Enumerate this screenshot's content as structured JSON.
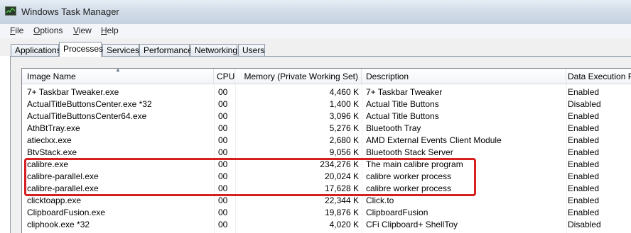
{
  "window": {
    "title": "Windows Task Manager"
  },
  "menu": [
    "File",
    "Options",
    "View",
    "Help"
  ],
  "tabs": [
    "Applications",
    "Processes",
    "Services",
    "Performance",
    "Networking",
    "Users"
  ],
  "active_tab": "Processes",
  "columns": {
    "name": "Image Name",
    "cpu": "CPU",
    "memory": "Memory (Private Working Set)",
    "description": "Description",
    "dep": "Data Execution Pre"
  },
  "rows": [
    {
      "name": "7+ Taskbar Tweaker.exe",
      "cpu": "00",
      "memory": "4,460 K",
      "description": "7+ Taskbar Tweaker",
      "dep": "Enabled"
    },
    {
      "name": "ActualTitleButtonsCenter.exe *32",
      "cpu": "00",
      "memory": "1,400 K",
      "description": "Actual Title Buttons",
      "dep": "Disabled"
    },
    {
      "name": "ActualTitleButtonsCenter64.exe",
      "cpu": "00",
      "memory": "3,096 K",
      "description": "Actual Title Buttons",
      "dep": "Enabled"
    },
    {
      "name": "AthBtTray.exe",
      "cpu": "00",
      "memory": "5,276 K",
      "description": "Bluetooth Tray",
      "dep": "Enabled"
    },
    {
      "name": "atieclxx.exe",
      "cpu": "00",
      "memory": "2,680 K",
      "description": "AMD External Events Client Module",
      "dep": "Enabled"
    },
    {
      "name": "BtvStack.exe",
      "cpu": "00",
      "memory": "9,056 K",
      "description": "Bluetooth Stack Server",
      "dep": "Enabled"
    },
    {
      "name": "calibre.exe",
      "cpu": "00",
      "memory": "234,276 K",
      "description": "The main calibre program",
      "dep": "Enabled"
    },
    {
      "name": "calibre-parallel.exe",
      "cpu": "00",
      "memory": "20,024 K",
      "description": "calibre worker process",
      "dep": "Enabled"
    },
    {
      "name": "calibre-parallel.exe",
      "cpu": "00",
      "memory": "17,628 K",
      "description": "calibre worker process",
      "dep": "Enabled"
    },
    {
      "name": "clicktoapp.exe",
      "cpu": "00",
      "memory": "22,344 K",
      "description": "Click.to",
      "dep": "Enabled"
    },
    {
      "name": "ClipboardFusion.exe",
      "cpu": "00",
      "memory": "19,876 K",
      "description": "ClipboardFusion",
      "dep": "Enabled"
    },
    {
      "name": "cliphook.exe *32",
      "cpu": "00",
      "memory": "4,020 K",
      "description": "CFi Clipboard+ ShellToy",
      "dep": "Disabled"
    }
  ],
  "annotation": {
    "color": "#d61f1f"
  }
}
